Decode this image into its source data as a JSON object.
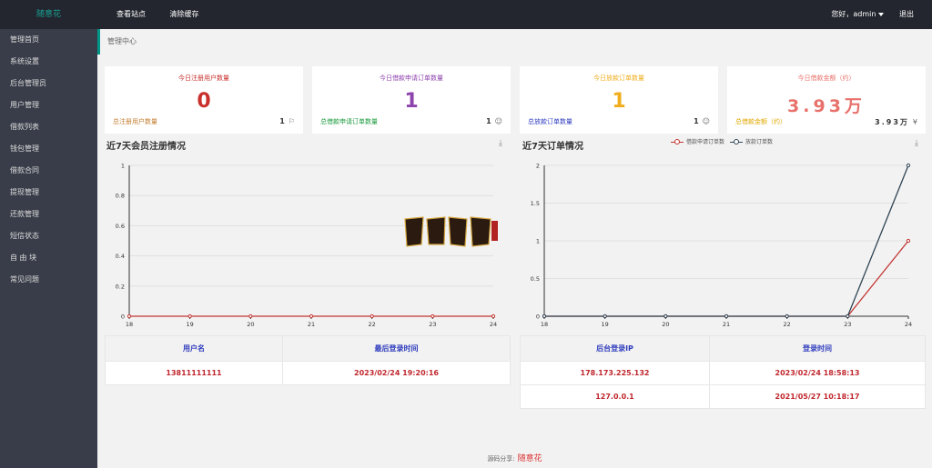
{
  "app": {
    "logo": "随意花"
  },
  "topnav": {
    "view_site": "查看站点",
    "clear_cache": "清除缓存"
  },
  "user": {
    "greeting": "您好，admin",
    "logout": "退出"
  },
  "sidebar": {
    "items": [
      {
        "label": "管理首页"
      },
      {
        "label": "系统设置"
      },
      {
        "label": "后台管理员"
      },
      {
        "label": "用户管理"
      },
      {
        "label": "借款列表"
      },
      {
        "label": "钱包管理"
      },
      {
        "label": "借款合同"
      },
      {
        "label": "提现管理"
      },
      {
        "label": "还款管理"
      },
      {
        "label": "短信状态"
      },
      {
        "label": "自 由 块"
      },
      {
        "label": "常见问题"
      }
    ]
  },
  "breadcrumb": "管理中心",
  "cards": [
    {
      "title": "今日注册用户数量",
      "value": "0",
      "foot": "总注册用户数量",
      "total": "1",
      "icon": "flag-icon",
      "color": "#c9302c",
      "foot_color": "#c37d2f"
    },
    {
      "title": "今日借款申请订单数量",
      "value": "1",
      "foot": "总借款申请订单数量",
      "total": "1",
      "icon": "smile-icon",
      "color": "#8e44ad",
      "foot_color": "#1a9b3c"
    },
    {
      "title": "今日放款订单数量",
      "value": "1",
      "foot": "总放款订单数量",
      "total": "1",
      "icon": "smile-icon",
      "color": "#f0ad1e",
      "foot_color": "#2f3cbd"
    },
    {
      "title": "今日借款金额（约）",
      "value": "3.93万",
      "foot": "总借款金额（约）",
      "total": "3.93万",
      "icon": "yen-icon",
      "color": "#e8716b",
      "foot_color": "#e0a800"
    }
  ],
  "chart_left_title": "近7天会员注册情况",
  "chart_right_title": "近7天订单情况",
  "chart_data": [
    {
      "type": "line",
      "x": [
        "18",
        "19",
        "20",
        "21",
        "22",
        "23",
        "24"
      ],
      "ylim": [
        0,
        1
      ],
      "yticks": [
        "0",
        "0.2",
        "0.4",
        "0.6",
        "0.8",
        "1"
      ],
      "series": [
        {
          "values": [
            0,
            0,
            0,
            0,
            0,
            0,
            0
          ],
          "color": "#c23531"
        }
      ]
    },
    {
      "type": "line",
      "x": [
        "18",
        "19",
        "20",
        "21",
        "22",
        "23",
        "24"
      ],
      "ylim": [
        0,
        2
      ],
      "yticks": [
        "0",
        "0.5",
        "1",
        "1.5",
        "2"
      ],
      "series": [
        {
          "name": "借款申请订单数",
          "values": [
            0,
            0,
            0,
            0,
            0,
            0,
            1
          ],
          "color": "#c23531"
        },
        {
          "name": "放款订单数",
          "values": [
            0,
            0,
            0,
            0,
            0,
            0,
            2
          ],
          "color": "#2f4554"
        }
      ]
    }
  ],
  "login_table": {
    "headers": [
      "用户名",
      "最后登录时间"
    ],
    "rows": [
      [
        "13811111111",
        "2023/02/24 19:20:16"
      ]
    ]
  },
  "ip_table": {
    "headers": [
      "后台登录IP",
      "登录时间"
    ],
    "rows": [
      [
        "178.173.225.132",
        "2023/02/24 18:58:13"
      ],
      [
        "127.0.0.1",
        "2021/05/27 10:18:17"
      ]
    ]
  },
  "footer": {
    "label": "源码分享:",
    "brand": "随意花"
  }
}
